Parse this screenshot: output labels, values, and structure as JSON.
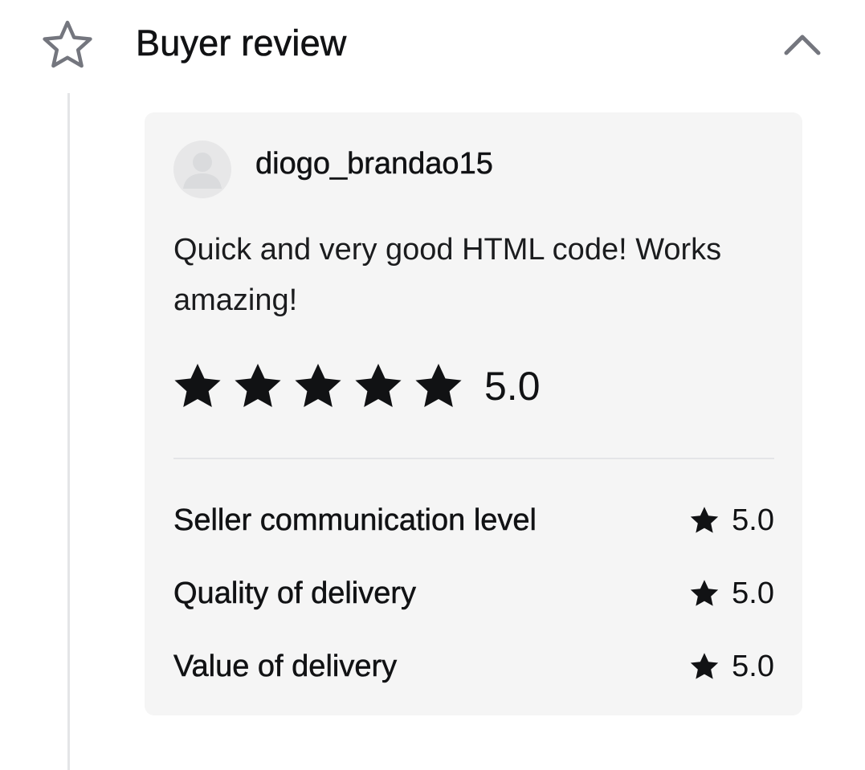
{
  "section": {
    "title": "Buyer review",
    "icon": "star-outline-icon",
    "toggle_icon": "chevron-up-icon"
  },
  "review": {
    "username": "diogo_brandao15",
    "avatar_icon": "user-avatar-icon",
    "text": "Quick and very good HTML code! Works amazing!",
    "rating": 5,
    "rating_max": 5,
    "rating_text": "5.0",
    "criteria": [
      {
        "label": "Seller communication level",
        "score": "5.0"
      },
      {
        "label": "Quality of delivery",
        "score": "5.0"
      },
      {
        "label": "Value of delivery",
        "score": "5.0"
      }
    ]
  },
  "colors": {
    "text": "#111214",
    "card_bg": "#f5f5f5",
    "divider": "#e4e5e7",
    "star_fill": "#111214",
    "icon_outline": "#74767e"
  }
}
